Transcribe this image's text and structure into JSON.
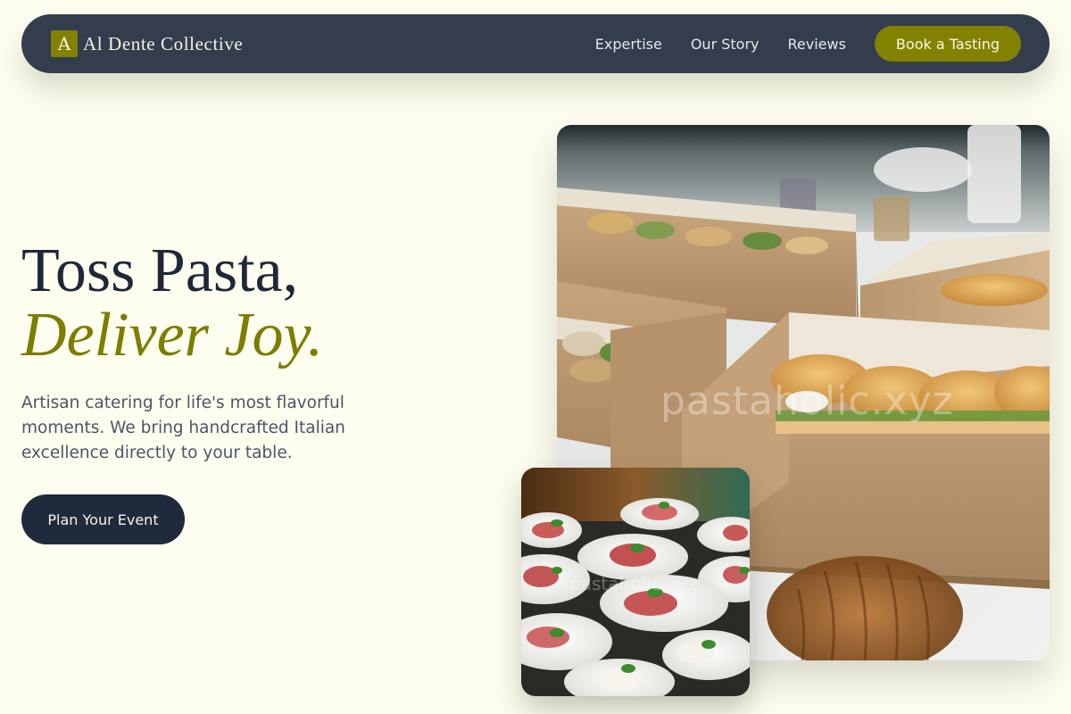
{
  "nav": {
    "brand_initial": "A",
    "brand_name": "Al Dente Collective",
    "links": [
      "Expertise",
      "Our Story",
      "Reviews"
    ],
    "cta_label": "Book a Tasting"
  },
  "hero": {
    "title_line1": "Toss Pasta,",
    "title_line2": "Deliver Joy.",
    "subtitle": "Artisan catering for life's most flavorful moments. We bring handcrafted Italian excellence directly to your table.",
    "cta_label": "Plan Your Event"
  },
  "images": {
    "main": {
      "watermark": "pastaholic.xyz",
      "subject": "catering boxes with focaccia sandwiches"
    },
    "small": {
      "watermark": "pastaholic.xyz",
      "subject": "plates of prosciutto and burrata appetizers"
    }
  },
  "colors": {
    "background": "#fdfeef",
    "nav_bg": "#333d4d",
    "accent_olive": "#838200",
    "dark_navy": "#1f2a3c",
    "text_muted": "#4a5565"
  }
}
